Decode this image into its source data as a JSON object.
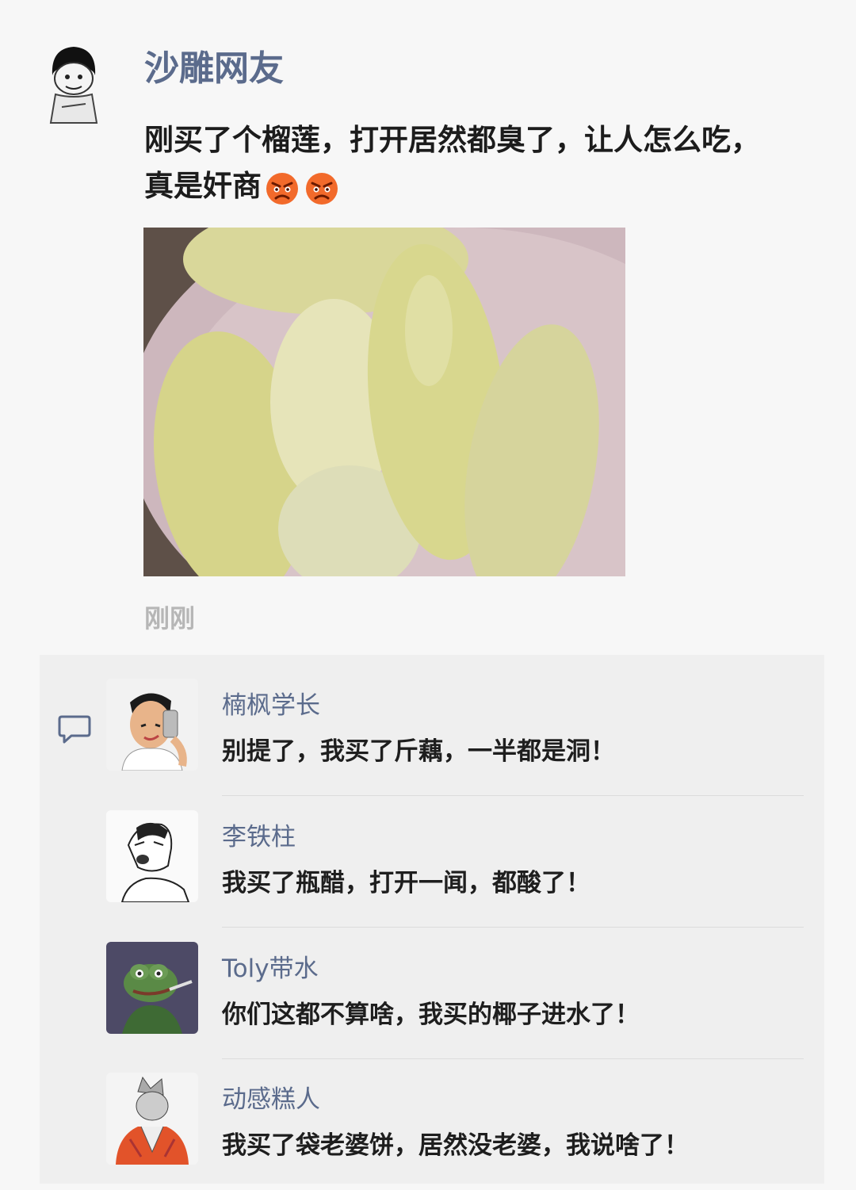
{
  "post": {
    "author": "沙雕网友",
    "text": "刚买了个榴莲，打开居然都臭了，让人怎么吃，真是奸商",
    "emojis": [
      "angry-face-icon",
      "angry-face-icon"
    ],
    "time": "刚刚"
  },
  "comments": [
    {
      "name": "楠枫学长",
      "text": "别提了，我买了斤藕，一半都是洞！"
    },
    {
      "name": "李铁柱",
      "text": "我买了瓶醋，打开一闻，都酸了！"
    },
    {
      "name": "Toly带水",
      "text": "你们这都不算啥，我买的椰子进水了！"
    },
    {
      "name": "动感糕人",
      "text": "我买了袋老婆饼，居然没老婆，我说啥了！"
    }
  ],
  "colors": {
    "author_name": "#5b6b8c",
    "timestamp": "#b6b6b6",
    "panel_bg": "#efefef",
    "page_bg": "#f7f7f7"
  }
}
